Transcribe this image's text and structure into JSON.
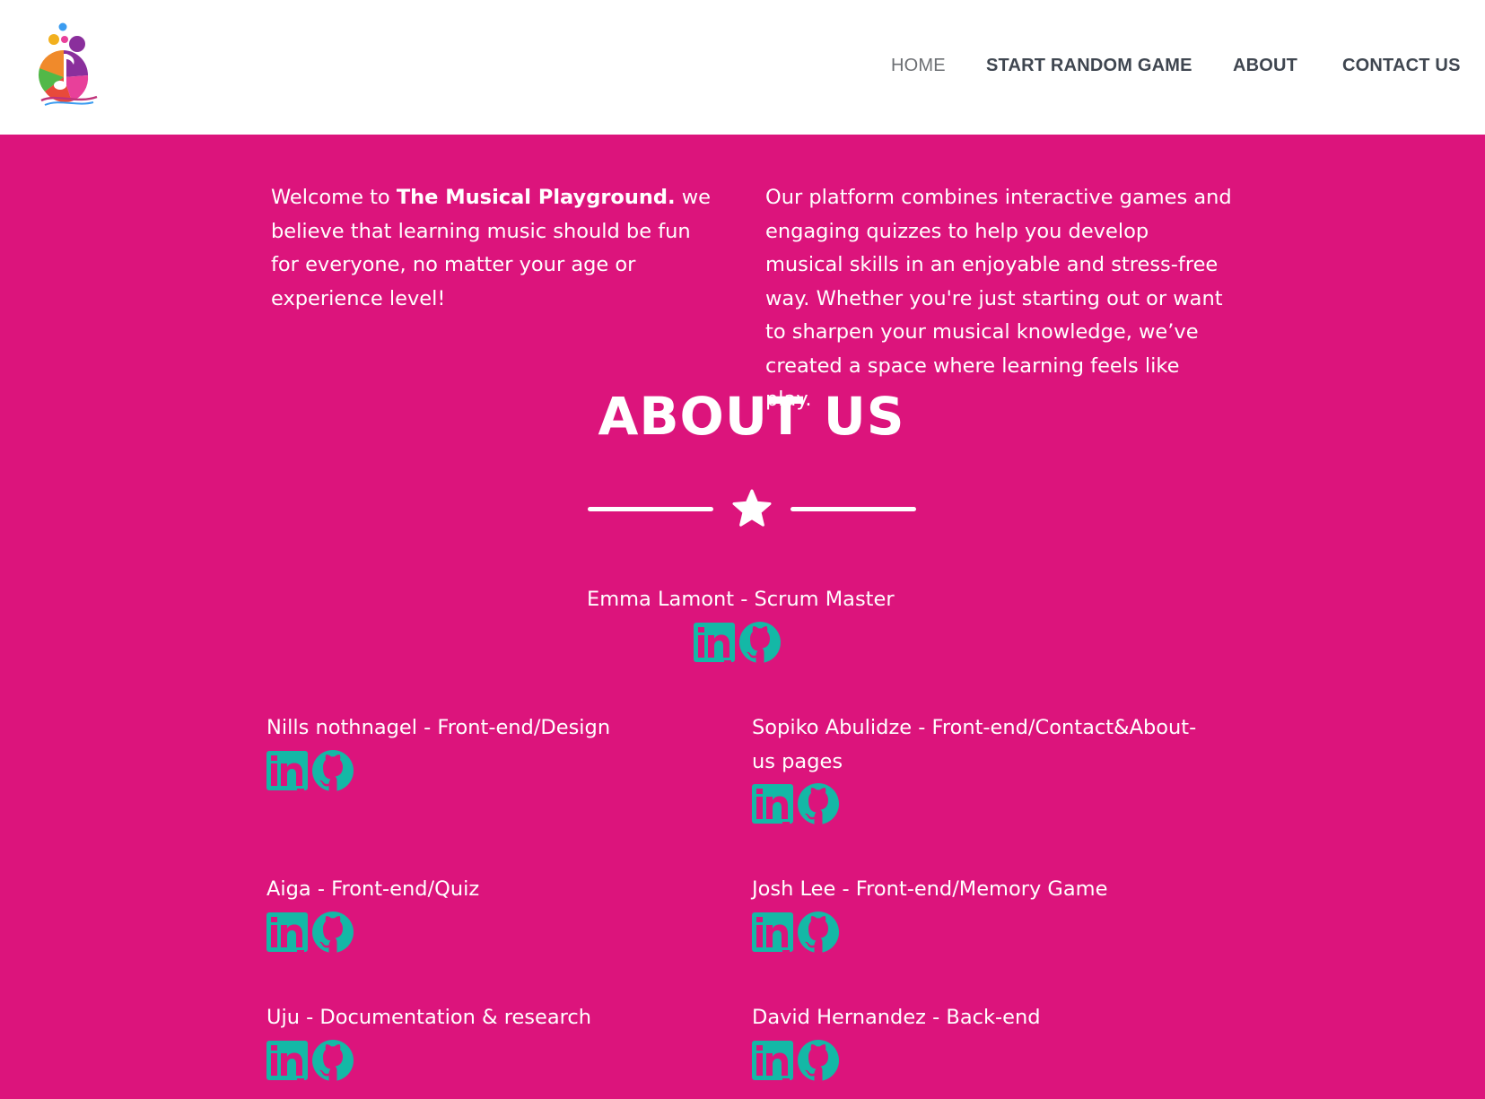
{
  "colors": {
    "accent": "#dc147c",
    "icon": "#14b8a6",
    "nav_text": "#3f4650",
    "nav_active": "#6c6f73"
  },
  "nav": {
    "logo_icon": "musical-playground-logo",
    "items": [
      {
        "label": "HOME",
        "active": true
      },
      {
        "label": "START RANDOM GAME",
        "active": false
      },
      {
        "label": "ABOUT",
        "active": false
      },
      {
        "label": "CONTACT US",
        "active": false
      }
    ]
  },
  "intro": {
    "left": {
      "prefix": "Welcome to ",
      "brand": "The Musical Playground.",
      "suffix": " we believe that learning music should be fun for everyone, no matter your age or experience level!"
    },
    "right": "Our platform combines interactive games and engaging quizzes to help you develop musical skills in an enjoyable and stress-free way. Whether you're just starting out or want to sharpen your musical knowledge, we’ve created a space where learning feels like play."
  },
  "about": {
    "title": "ABOUT US",
    "divider_icon": "star-icon"
  },
  "team": [
    {
      "name": "Emma Lamont - Scrum Master",
      "icons": [
        "linkedin-icon",
        "github-icon"
      ]
    },
    {
      "name": "Nills nothnagel - Front-end/Design",
      "icons": [
        "linkedin-icon",
        "github-icon"
      ]
    },
    {
      "name": "Sopiko Abulidze - Front-end/Contact&About-us pages",
      "icons": [
        "linkedin-icon",
        "github-icon"
      ]
    },
    {
      "name": "Aiga - Front-end/Quiz",
      "icons": [
        "linkedin-icon",
        "github-icon"
      ]
    },
    {
      "name": "Josh Lee - Front-end/Memory Game",
      "icons": [
        "linkedin-icon",
        "github-icon"
      ]
    },
    {
      "name": "Uju - Documentation & research",
      "icons": [
        "linkedin-icon",
        "github-icon"
      ]
    },
    {
      "name": "David Hernandez - Back-end",
      "icons": [
        "linkedin-icon",
        "github-icon"
      ]
    }
  ]
}
